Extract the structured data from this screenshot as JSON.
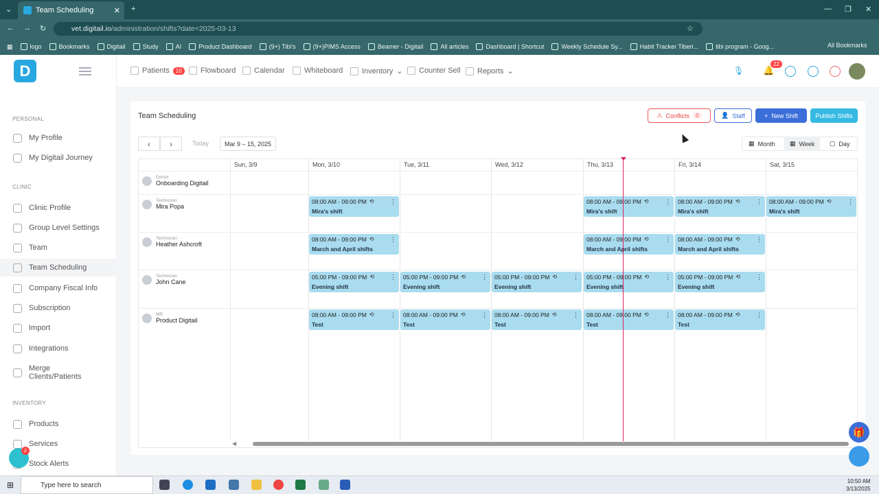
{
  "browser": {
    "tab_title": "Team Scheduling",
    "url_host": "vet.digitail.io",
    "url_path": "/administration/shifts?date=2025-03-13",
    "bookmarks": [
      "logo",
      "Bookmarks",
      "Digitail",
      "Study",
      "AI",
      "Product Dashboard",
      "(9+) Tibi's",
      "(9+)PIMS Access",
      "Beamer - Digitail",
      "All articles",
      "Dashboard | Shortcut",
      "Weekly Schedule Sy...",
      "Habit Tracker Tiberi...",
      "tibi program - Goog..."
    ],
    "all_bookmarks": "All Bookmarks"
  },
  "nav": {
    "patients": "Patients",
    "patients_badge": "10",
    "flowboard": "Flowboard",
    "calendar": "Calendar",
    "whiteboard": "Whiteboard",
    "inventory": "Inventory",
    "counter_sell": "Counter Sell",
    "reports": "Reports",
    "notif_badge": "22"
  },
  "sidebar": {
    "personal": "PERSONAL",
    "personal_items": [
      "My Profile",
      "My Digitail Journey"
    ],
    "clinic": "CLINIC",
    "clinic_items": [
      "Clinic Profile",
      "Group Level Settings",
      "Team",
      "Team Scheduling",
      "Company Fiscal Info",
      "Subscription",
      "Import",
      "Integrations",
      "Merge Clients/Patients"
    ],
    "inventory": "INVENTORY",
    "inventory_items": [
      "Products",
      "Services",
      "Stock Alerts"
    ],
    "chat_badge": "2"
  },
  "page": {
    "title": "Team Scheduling",
    "conflicts": "Conflicts",
    "conflicts_count": "0",
    "staff": "Staff",
    "new_shift": "New Shift",
    "publish": "Publish Shifts",
    "today": "Today",
    "range": "Mar 9 – 15, 2025",
    "month": "Month",
    "week": "Week",
    "day": "Day"
  },
  "days": [
    "Sun, 3/9",
    "Mon, 3/10",
    "Tue, 3/11",
    "Wed, 3/12",
    "Thu, 3/13",
    "Fri, 3/14",
    "Sat, 3/15"
  ],
  "staff": [
    {
      "role": "Doctor",
      "name": "Onboarding Digitail"
    },
    {
      "role": "Technician",
      "name": "Mira Popa"
    },
    {
      "role": "Technician",
      "name": "Heather Ashcroft"
    },
    {
      "role": "Technician",
      "name": "John Cane"
    },
    {
      "role": "MR",
      "name": "Product Digitail"
    }
  ],
  "shifts": [
    {
      "row": 1,
      "day": 1,
      "time": "08:00 AM - 09:00 PM",
      "name": "Mira's shift"
    },
    {
      "row": 1,
      "day": 4,
      "time": "08:00 AM - 09:00 PM",
      "name": "Mira's shift"
    },
    {
      "row": 1,
      "day": 5,
      "time": "08:00 AM - 09:00 PM",
      "name": "Mira's shift"
    },
    {
      "row": 1,
      "day": 6,
      "time": "08:00 AM - 09:00 PM",
      "name": "Mira's shift"
    },
    {
      "row": 2,
      "day": 1,
      "time": "08:00 AM - 09:00 PM",
      "name": "March and April shifts"
    },
    {
      "row": 2,
      "day": 4,
      "time": "08:00 AM - 09:00 PM",
      "name": "March and April shifts"
    },
    {
      "row": 2,
      "day": 5,
      "time": "08:00 AM - 09:00 PM",
      "name": "March and April shifts"
    },
    {
      "row": 3,
      "day": 1,
      "time": "05:00 PM - 09:00 PM",
      "name": "Evening shift"
    },
    {
      "row": 3,
      "day": 2,
      "time": "05:00 PM - 09:00 PM",
      "name": "Evening shift"
    },
    {
      "row": 3,
      "day": 3,
      "time": "05:00 PM - 09:00 PM",
      "name": "Evening shift"
    },
    {
      "row": 3,
      "day": 4,
      "time": "05:00 PM - 09:00 PM",
      "name": "Evening shift"
    },
    {
      "row": 3,
      "day": 5,
      "time": "05:00 PM - 09:00 PM",
      "name": "Evening shift"
    },
    {
      "row": 4,
      "day": 1,
      "time": "08:00 AM - 09:00 PM",
      "name": "Test"
    },
    {
      "row": 4,
      "day": 2,
      "time": "08:00 AM - 09:00 PM",
      "name": "Test"
    },
    {
      "row": 4,
      "day": 3,
      "time": "08:00 AM - 09:00 PM",
      "name": "Test"
    },
    {
      "row": 4,
      "day": 4,
      "time": "08:00 AM - 09:00 PM",
      "name": "Test"
    },
    {
      "row": 4,
      "day": 5,
      "time": "08:00 AM - 09:00 PM",
      "name": "Test"
    }
  ],
  "taskbar": {
    "search_placeholder": "Type here to search",
    "time": "10:50 AM",
    "date": "3/13/2025"
  }
}
